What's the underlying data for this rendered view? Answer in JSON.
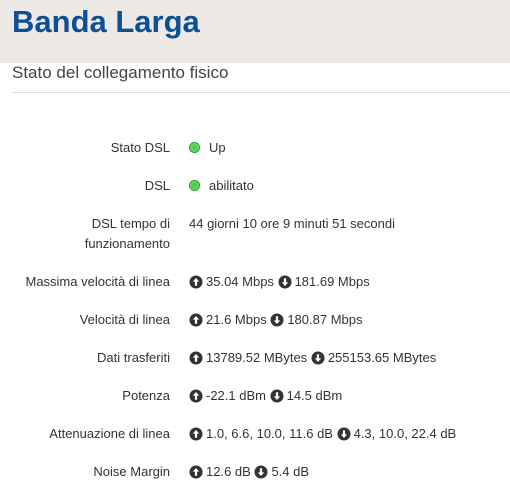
{
  "header": {
    "title": "Banda Larga"
  },
  "section": {
    "title": "Stato del collegamento fisico"
  },
  "rows": [
    {
      "label": "Stato DSL",
      "value": "Up"
    },
    {
      "label": "DSL",
      "value": "abilitato"
    },
    {
      "label_line1": "DSL tempo di",
      "label_line2": "funzionamento",
      "value": "44 giorni 10 ore 9 minuti 51 secondi"
    },
    {
      "label": "Massima velocità di linea",
      "up": "35.04 Mbps",
      "down": "181.69 Mbps"
    },
    {
      "label": "Velocità di linea",
      "up": "21.6 Mbps",
      "down": "180.87 Mbps"
    },
    {
      "label": "Dati trasferiti",
      "up": "13789.52 MBytes",
      "down": "255153.65 MBytes"
    },
    {
      "label": "Potenza",
      "up": "-22.1 dBm",
      "down": "14.5 dBm"
    },
    {
      "label": "Attenuazione di linea",
      "up": "1.0, 6.6, 10.0, 11.6 dB",
      "down": "4.3, 10.0, 22.4 dB"
    },
    {
      "label": "Noise Margin",
      "up": "12.6 dB",
      "down": "5.4 dB"
    }
  ],
  "colors": {
    "header_bg": "#ece9e6",
    "title": "#0e4f94",
    "status_ok": "#4cd14c"
  },
  "icons": {
    "status": "green-dot-icon",
    "upstream": "arrow-up-circle-icon",
    "downstream": "arrow-down-circle-icon"
  }
}
